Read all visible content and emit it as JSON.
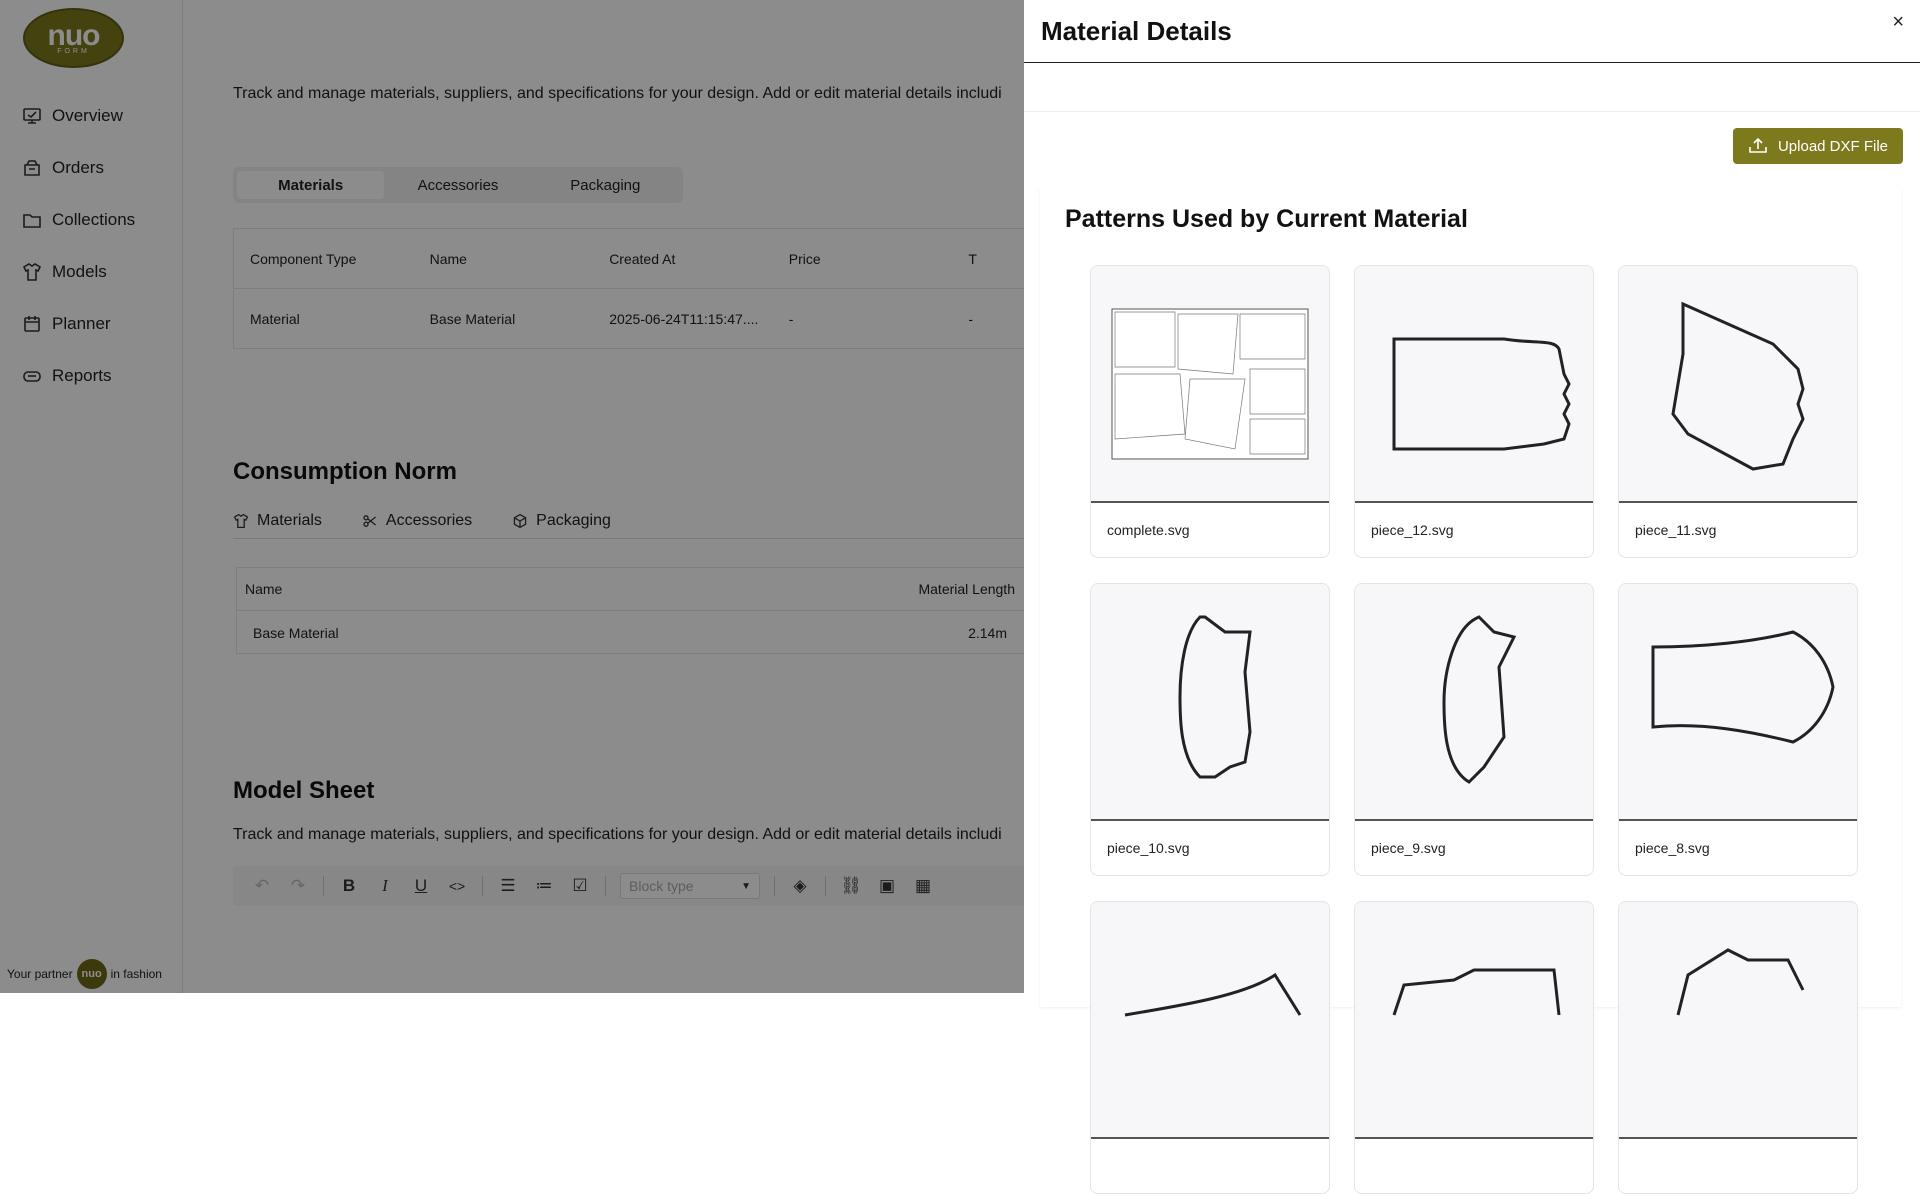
{
  "brand": {
    "logo_text": "nuo",
    "logo_sub": "FORM",
    "footer_prefix": "Your partner",
    "footer_badge": "nuo",
    "footer_suffix": "in fashion"
  },
  "sidebar": {
    "items": [
      {
        "label": "Overview",
        "icon": "overview-icon"
      },
      {
        "label": "Orders",
        "icon": "orders-icon"
      },
      {
        "label": "Collections",
        "icon": "folder-icon"
      },
      {
        "label": "Models",
        "icon": "shirt-icon"
      },
      {
        "label": "Planner",
        "icon": "calendar-icon"
      },
      {
        "label": "Reports",
        "icon": "reports-icon"
      }
    ]
  },
  "main": {
    "description": "Track and manage materials, suppliers, and specifications for your design. Add or edit material details includi",
    "segment_tabs": [
      "Materials",
      "Accessories",
      "Packaging"
    ],
    "table": {
      "headers": [
        "Component Type",
        "Name",
        "Created At",
        "Price",
        "T"
      ],
      "row": [
        "Material",
        "Base Material",
        "2025-06-24T11:15:47....",
        "-",
        "-"
      ]
    },
    "consumption": {
      "title": "Consumption Norm",
      "tabs": [
        "Materials",
        "Accessories",
        "Packaging"
      ],
      "headers": [
        "Name",
        "Material Length"
      ],
      "row": [
        "Base Material",
        "2.14m"
      ]
    },
    "model_sheet": {
      "title": "Model Sheet",
      "description": "Track and manage materials, suppliers, and specifications for your design. Add or edit material details includi",
      "block_type_placeholder": "Block type"
    }
  },
  "drawer": {
    "title": "Material Details",
    "close": "×",
    "upload_label": "Upload DXF File",
    "patterns_title": "Patterns Used by Current Material",
    "patterns": [
      "complete.svg",
      "piece_12.svg",
      "piece_11.svg",
      "piece_10.svg",
      "piece_9.svg",
      "piece_8.svg",
      "",
      "",
      ""
    ]
  },
  "colors": {
    "accent": "#7d7a1e",
    "overlay": "rgba(0,0,0,0.45)"
  }
}
